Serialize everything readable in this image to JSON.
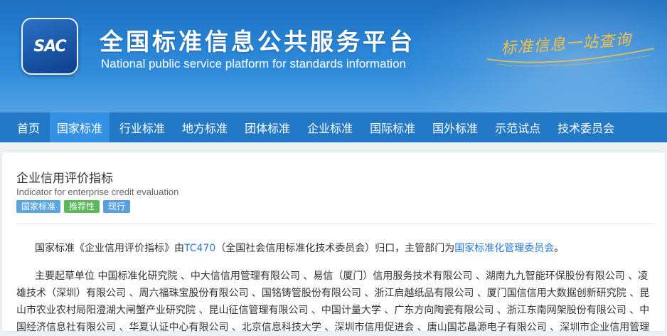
{
  "header": {
    "logo_text": "SAC",
    "title": "全国标准信息公共服务平台",
    "subtitle": "National public service platform  for standards information",
    "slogan": "标准信息一站查询"
  },
  "nav": {
    "items": [
      {
        "label": "首页",
        "active": false
      },
      {
        "label": "国家标准",
        "active": true
      },
      {
        "label": "行业标准",
        "active": false
      },
      {
        "label": "地方标准",
        "active": false
      },
      {
        "label": "团体标准",
        "active": false
      },
      {
        "label": "企业标准",
        "active": false
      },
      {
        "label": "国际标准",
        "active": false
      },
      {
        "label": "国外标准",
        "active": false
      },
      {
        "label": "示范试点",
        "active": false
      },
      {
        "label": "技术委员会",
        "active": false
      }
    ]
  },
  "standard": {
    "title": "企业信用评价指标",
    "title_en": "Indicator for enterprise credit evaluation",
    "tags": [
      "国家标准",
      "推荐性",
      "现行"
    ],
    "intro": {
      "prefix": "国家标准《企业信用评价指标》由",
      "tc_link": "TC470",
      "middle": "（全国社会信用标准化技术委员会）归口，主管部门为",
      "dept_link": "国家标准化管理委员会",
      "suffix": "。"
    },
    "drafters_text": "主要起草单位 中国标准化研究院 、中大信信用管理有限公司 、易信（厦门）信用服务技术有限公司 、湖南九九智能环保股份有限公司 、凌雄技术（深圳）有限公司 、周六福珠宝股份有限公司 、国铭铸管股份有限公司 、浙江启越纸品有限公司 、厦门国信信用大数据创新研究院 、昆山市农业农村局阳澄湖大闸蟹产业研究院 、昆山征信管理有限公司 、中国计量大学 、广东方向陶瓷有限公司 、浙江东南网架股份有限公司 、中国经济信息社有限公司 、华夏认证中心有限公司 、北京信息科技大学 、深圳市信用促进会 、唐山国芯晶源电子有限公司 、深圳市企业信用管理"
  },
  "colors": {
    "nav_bg": "#2479c6",
    "nav_active": "#3491e3",
    "link": "#2a7ad0",
    "slogan": "#f6c043"
  }
}
